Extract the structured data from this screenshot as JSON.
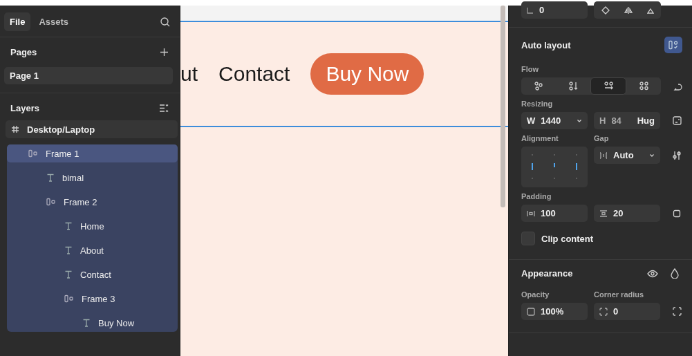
{
  "left_panel": {
    "tabs": [
      {
        "label": "File",
        "selected": true
      },
      {
        "label": "Assets",
        "selected": false
      }
    ],
    "pages": {
      "title": "Pages",
      "items": [
        {
          "label": "Page 1",
          "selected": true
        }
      ]
    },
    "layers": {
      "title": "Layers",
      "tree": [
        {
          "label": "Desktop/Laptop",
          "kind": "frame",
          "selected": false,
          "children": [
            {
              "label": "Frame 1",
              "kind": "autolayout",
              "selected": true,
              "children": [
                {
                  "label": "bimal",
                  "kind": "text",
                  "selected": false
                },
                {
                  "label": "Frame 2",
                  "kind": "autolayout",
                  "selected": false,
                  "children": [
                    {
                      "label": "Home",
                      "kind": "text",
                      "selected": false
                    },
                    {
                      "label": "About",
                      "kind": "text",
                      "selected": false
                    },
                    {
                      "label": "Contact",
                      "kind": "text",
                      "selected": false
                    },
                    {
                      "label": "Frame 3",
                      "kind": "autolayout",
                      "selected": false,
                      "children": [
                        {
                          "label": "Buy Now",
                          "kind": "text",
                          "selected": false
                        }
                      ]
                    }
                  ]
                }
              ]
            }
          ]
        }
      ]
    }
  },
  "canvas": {
    "nav_links": [
      "ut",
      "Contact"
    ],
    "button": "Buy Now"
  },
  "properties": {
    "top_field": {
      "value": "0"
    },
    "auto_layout": {
      "title": "Auto layout",
      "enabled": true,
      "flow": {
        "label": "Flow",
        "options": [
          {
            "kind": "freeform",
            "selected": false
          },
          {
            "kind": "vertical",
            "selected": false
          },
          {
            "kind": "horizontal",
            "selected": true
          },
          {
            "kind": "grid",
            "selected": false
          }
        ]
      },
      "resizing": {
        "label": "Resizing",
        "width": {
          "prefix": "W",
          "value": "1440"
        },
        "height": {
          "prefix": "H",
          "value": "84",
          "mode": "Hug"
        }
      },
      "alignment": {
        "label": "Alignment"
      },
      "gap": {
        "label": "Gap",
        "value": "Auto"
      },
      "padding": {
        "label": "Padding",
        "horizontal": "100",
        "vertical": "20"
      },
      "clip_content": {
        "label": "Clip content",
        "checked": false
      }
    },
    "appearance": {
      "title": "Appearance",
      "opacity": {
        "label": "Opacity",
        "value": "100%"
      },
      "corner_radius": {
        "label": "Corner radius",
        "value": "0"
      }
    }
  }
}
